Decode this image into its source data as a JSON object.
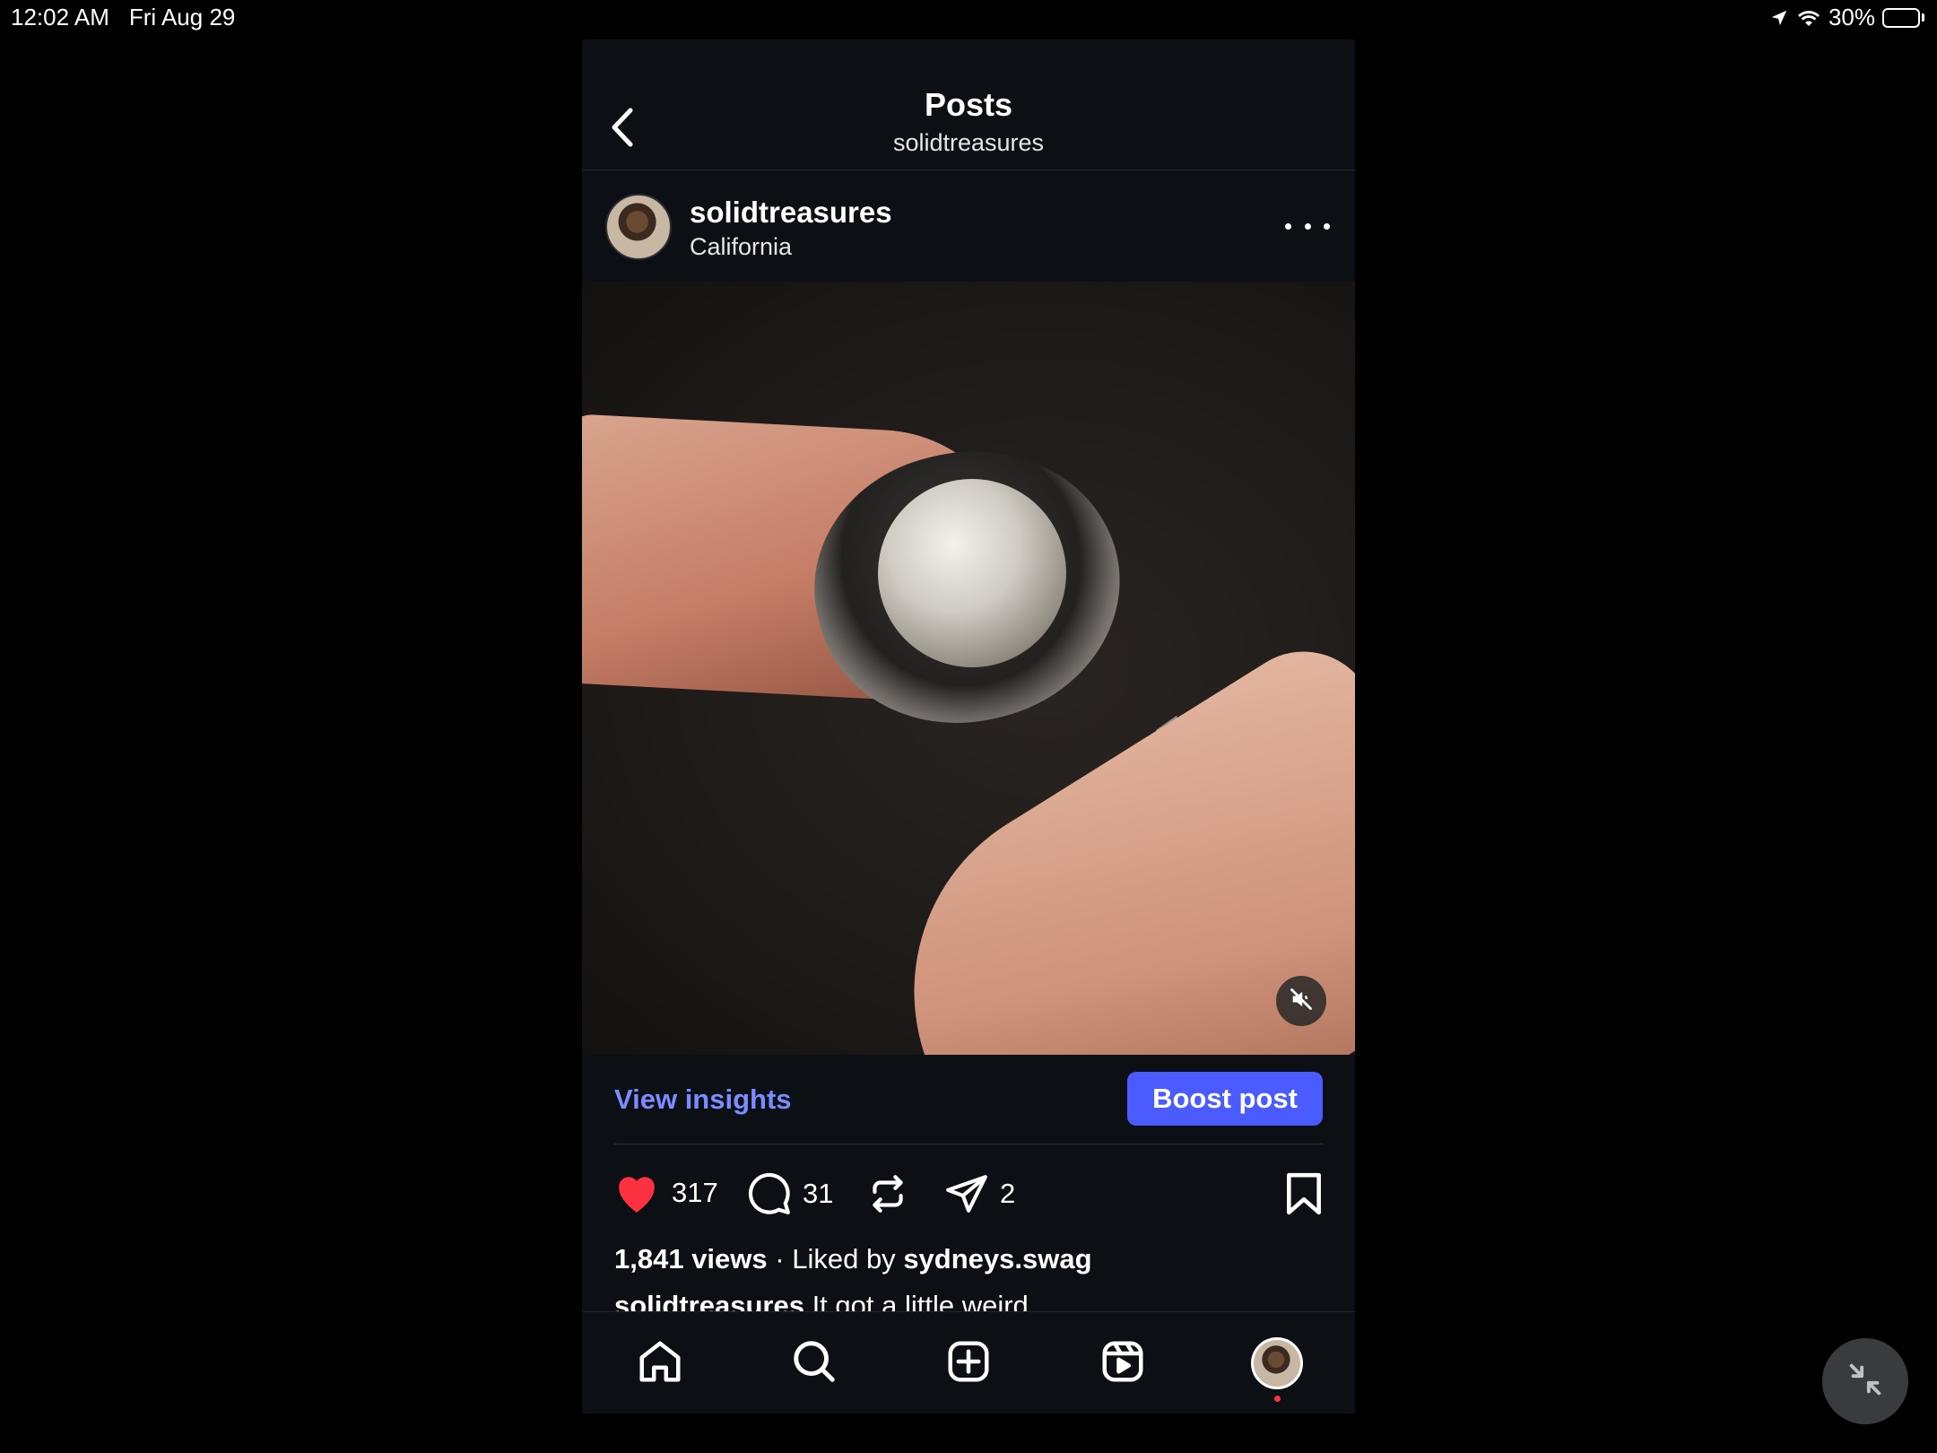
{
  "status_bar": {
    "time": "12:02 AM",
    "date": "Fri Aug 29",
    "battery_percent": "30%",
    "battery_level": 0.3
  },
  "header": {
    "title": "Posts",
    "subtitle": "solidtreasures"
  },
  "post": {
    "username": "solidtreasures",
    "location": "California",
    "media_description_icon": "muted-speaker-icon"
  },
  "insights": {
    "view_insights_label": "View insights",
    "boost_label": "Boost post"
  },
  "actions": {
    "likes": "317",
    "comments": "31",
    "shares": "2"
  },
  "stats": {
    "views": "1,841 views",
    "separator": "·",
    "liked_by_prefix": "Liked by",
    "liked_by_user": "sydneys.swag"
  },
  "caption": {
    "username": "solidtreasures",
    "text": "It got a little weird"
  },
  "colors": {
    "accent": "#4a5cff",
    "link": "#7a8cff",
    "like": "#ff3040",
    "background": "#0c0f14"
  }
}
